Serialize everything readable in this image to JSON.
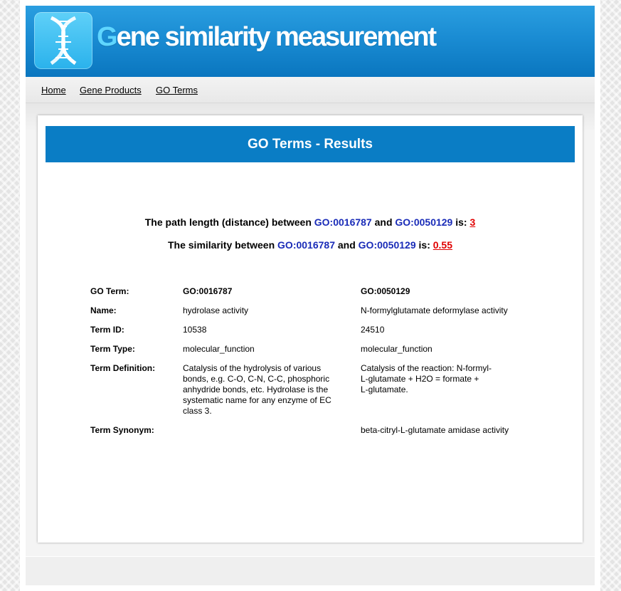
{
  "header": {
    "title_first": "G",
    "title_rest": "ene similarity measurement"
  },
  "nav": {
    "items": [
      "Home",
      "Gene Products",
      "GO Terms"
    ]
  },
  "results": {
    "title": "GO Terms - Results",
    "path_line": {
      "prefix": "The path length (distance) between ",
      "term1": "GO:0016787",
      "and": " and ",
      "term2": "GO:0050129",
      "is": " is: ",
      "value": "3"
    },
    "similarity_line": {
      "prefix": "The similarity between ",
      "term1": "GO:0016787",
      "and": " and ",
      "term2": "GO:0050129",
      "is": " is: ",
      "value": "0.55"
    }
  },
  "table": {
    "header": {
      "label": "GO Term:",
      "col1": "GO:0016787",
      "col2": "GO:0050129"
    },
    "rows": [
      {
        "label": "Name:",
        "col1": "hydrolase activity",
        "col2": "N-formylglutamate deformylase activity"
      },
      {
        "label": "Term ID:",
        "col1": "10538",
        "col2": "24510"
      },
      {
        "label": "Term Type:",
        "col1": "molecular_function",
        "col2": "molecular_function"
      },
      {
        "label": "Term Definition:",
        "col1_lines": [
          "Catalysis of the hydrolysis of various",
          "bonds, e.g. C-O, C-N, C-C, phosphoric",
          "anhydride bonds, etc. Hydrolase is the",
          "systematic name for any enzyme of EC",
          "class 3."
        ],
        "col2_lines": [
          "Catalysis of the reaction: N-formyl-",
          "L-glutamate + H2O = formate +",
          "L-glutamate."
        ]
      },
      {
        "label": "Term Synonym:",
        "col1": "",
        "col2": "beta-citryl-L-glutamate amidase activity"
      }
    ]
  },
  "colors": {
    "header_blue": "#1a8cd3",
    "results_bar": "#0a7dc5",
    "go_id": "#1a2cb8",
    "value_red": "#e00000"
  }
}
